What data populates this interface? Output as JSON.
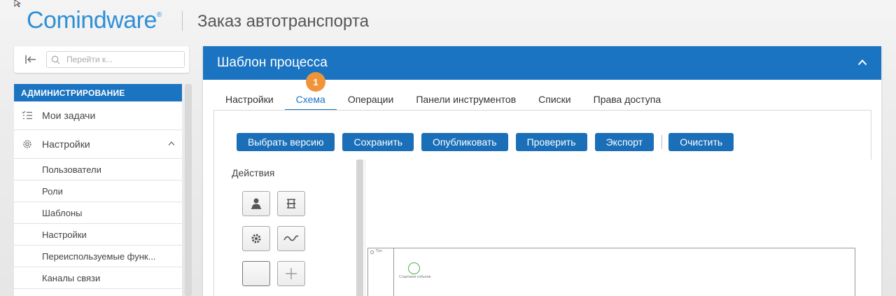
{
  "header": {
    "logo_text": "Comindware",
    "logo_reg": "®",
    "app_title": "Заказ автотранспорта",
    "brand_color": "#2e8fd6"
  },
  "sidebar": {
    "search_placeholder": "Перейти к...",
    "section_title": "АДМИНИСТРИРОВАНИЕ",
    "items": [
      {
        "label": "Мои задачи",
        "icon": "task-list-icon"
      },
      {
        "label": "Настройки",
        "icon": "gear-icon",
        "expanded": true
      }
    ],
    "subitems": [
      "Пользователи",
      "Роли",
      "Шаблоны",
      "Настройки",
      "Переиспользуемые функ...",
      "Каналы связи"
    ]
  },
  "panel": {
    "title": "Шаблон процесса",
    "accent": "#1a74c1",
    "tabs": [
      {
        "label": "Настройки",
        "active": false
      },
      {
        "label": "Схема",
        "active": true
      },
      {
        "label": "Операции",
        "active": false
      },
      {
        "label": "Панели инструментов",
        "active": false
      },
      {
        "label": "Списки",
        "active": false
      },
      {
        "label": "Права доступа",
        "active": false
      }
    ],
    "step_badge": "1",
    "step_badge_color": "#f0943a",
    "toolbar": {
      "select_version": "Выбрать версию",
      "save": "Сохранить",
      "publish": "Опубликовать",
      "check": "Проверить",
      "export": "Экспорт",
      "clear": "Очистить"
    },
    "actions_label": "Действия",
    "action_icons": [
      "user-task-icon",
      "script-task-icon",
      "service-task-icon",
      "subprocess-icon",
      "empty-task-icon",
      "add-icon"
    ],
    "canvas": {
      "pool_label": "Пул",
      "start_event_label": "Стартовое событие"
    }
  }
}
